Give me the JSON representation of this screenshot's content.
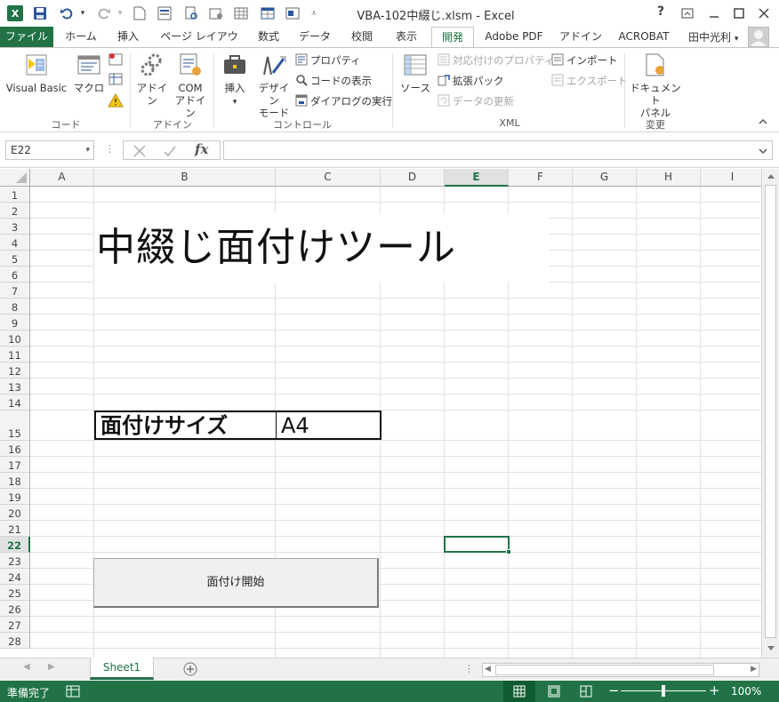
{
  "window": {
    "title": "VBA-102中綴じ.xlsm - Excel",
    "help": "?",
    "app_icon_label": "X"
  },
  "tabs": [
    "ファイル",
    "ホーム",
    "挿入",
    "ページ レイアウト",
    "数式",
    "データ",
    "校閲",
    "表示",
    "開発",
    "Adobe PDF",
    "アドイン",
    "ACROBAT"
  ],
  "user": {
    "name": "田中光利"
  },
  "ribbon": {
    "code": {
      "visual_basic": "Visual Basic",
      "macro": "マクロ",
      "label": "コード"
    },
    "addins": {
      "addin": "アドイン",
      "com_line1": "COM",
      "com_line2": "アドイン",
      "label": "アドイン"
    },
    "controls": {
      "insert": "挿入",
      "design_line1": "デザイン",
      "design_line2": "モード",
      "properties": "プロパティ",
      "view_code": "コードの表示",
      "run_dialog": "ダイアログの実行",
      "label": "コントロール"
    },
    "xml": {
      "source": "ソース",
      "map_properties": "対応付けのプロパティ",
      "expansion_packs": "拡張パック",
      "refresh_data": "データの更新",
      "import": "インポート",
      "export": "エクスポート",
      "label": "XML"
    },
    "modify": {
      "doc_panel_line1": "ドキュメント",
      "doc_panel_line2": "パネル",
      "label": "変更"
    }
  },
  "formula": {
    "name_box": "E22",
    "value": ""
  },
  "grid": {
    "columns": [
      "A",
      "B",
      "C",
      "D",
      "E",
      "F",
      "G",
      "H",
      "I"
    ],
    "rows": [
      "1",
      "2",
      "3",
      "4",
      "5",
      "6",
      "7",
      "8",
      "9",
      "10",
      "11",
      "12",
      "13",
      "14",
      "15",
      "16",
      "17",
      "18",
      "19",
      "20",
      "21",
      "22",
      "23",
      "24",
      "25",
      "26",
      "27",
      "28"
    ],
    "selected_cell": "E22"
  },
  "content": {
    "title": "中綴じ面付けツール",
    "size_label": "面付けサイズ",
    "size_value": "A4",
    "start_button": "面付け開始"
  },
  "sheets": [
    "Sheet1"
  ],
  "status": {
    "ready": "準備完了",
    "zoom": "100%",
    "zoom_level": 1.0
  },
  "colors": {
    "accent": "#217346"
  }
}
